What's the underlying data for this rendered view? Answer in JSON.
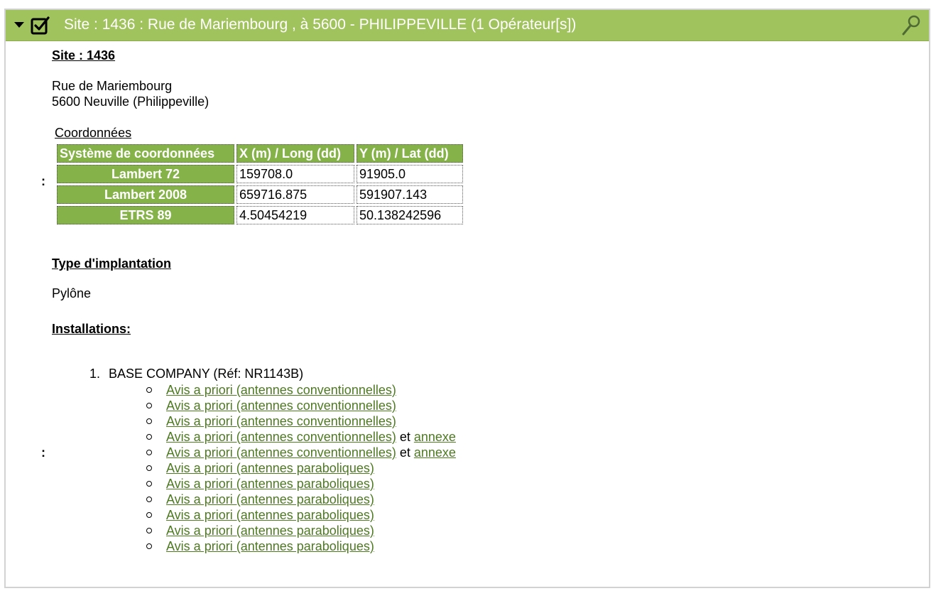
{
  "header": {
    "title": "Site : 1436 : Rue de Mariembourg , à 5600 - PHILIPPEVILLE (1 Opérateur[s])",
    "accent_color": "#a1c35e",
    "icons": [
      "caret-down-icon",
      "checkbox-checked-icon",
      "magnifier-icon"
    ]
  },
  "site": {
    "heading": "Site : 1436",
    "address_line1": "Rue de Mariembourg",
    "address_line2": "5600 Neuville (Philippeville)"
  },
  "coordinates": {
    "caption": "Coordonnées",
    "colon": ":",
    "headers": [
      "Système de coordonnées",
      "X (m) / Long (dd)",
      "Y (m) / Lat (dd)"
    ],
    "rows": [
      {
        "system": "Lambert 72",
        "x": "159708.0",
        "y": "91905.0"
      },
      {
        "system": "Lambert 2008",
        "x": "659716.875",
        "y": "591907.143"
      },
      {
        "system": "ETRS 89",
        "x": "4.50454219",
        "y": "50.138242596"
      }
    ]
  },
  "implantation": {
    "heading": "Type d'implantation",
    "value": "Pylône"
  },
  "installations": {
    "heading": "Installations:",
    "colon": ":",
    "operator_number": "1.",
    "operator": "BASE COMPANY (Réf: NR1143B)",
    "links": [
      {
        "text": "Avis a priori (antennes conventionnelles)",
        "sep": "",
        "extra": ""
      },
      {
        "text": "Avis a priori (antennes conventionnelles)",
        "sep": "",
        "extra": ""
      },
      {
        "text": "Avis a priori (antennes conventionnelles)",
        "sep": "",
        "extra": ""
      },
      {
        "text": "Avis a priori (antennes conventionnelles)",
        "sep": " et ",
        "extra": "annexe"
      },
      {
        "text": "Avis a priori (antennes conventionnelles)",
        "sep": " et ",
        "extra": "annexe"
      },
      {
        "text": "Avis a priori (antennes paraboliques)",
        "sep": "",
        "extra": ""
      },
      {
        "text": "Avis a priori (antennes paraboliques)",
        "sep": "",
        "extra": ""
      },
      {
        "text": "Avis a priori (antennes paraboliques)",
        "sep": "",
        "extra": ""
      },
      {
        "text": "Avis a priori (antennes paraboliques)",
        "sep": "",
        "extra": ""
      },
      {
        "text": "Avis a priori (antennes paraboliques)",
        "sep": "",
        "extra": ""
      },
      {
        "text": "Avis a priori (antennes paraboliques)",
        "sep": "",
        "extra": ""
      }
    ]
  }
}
